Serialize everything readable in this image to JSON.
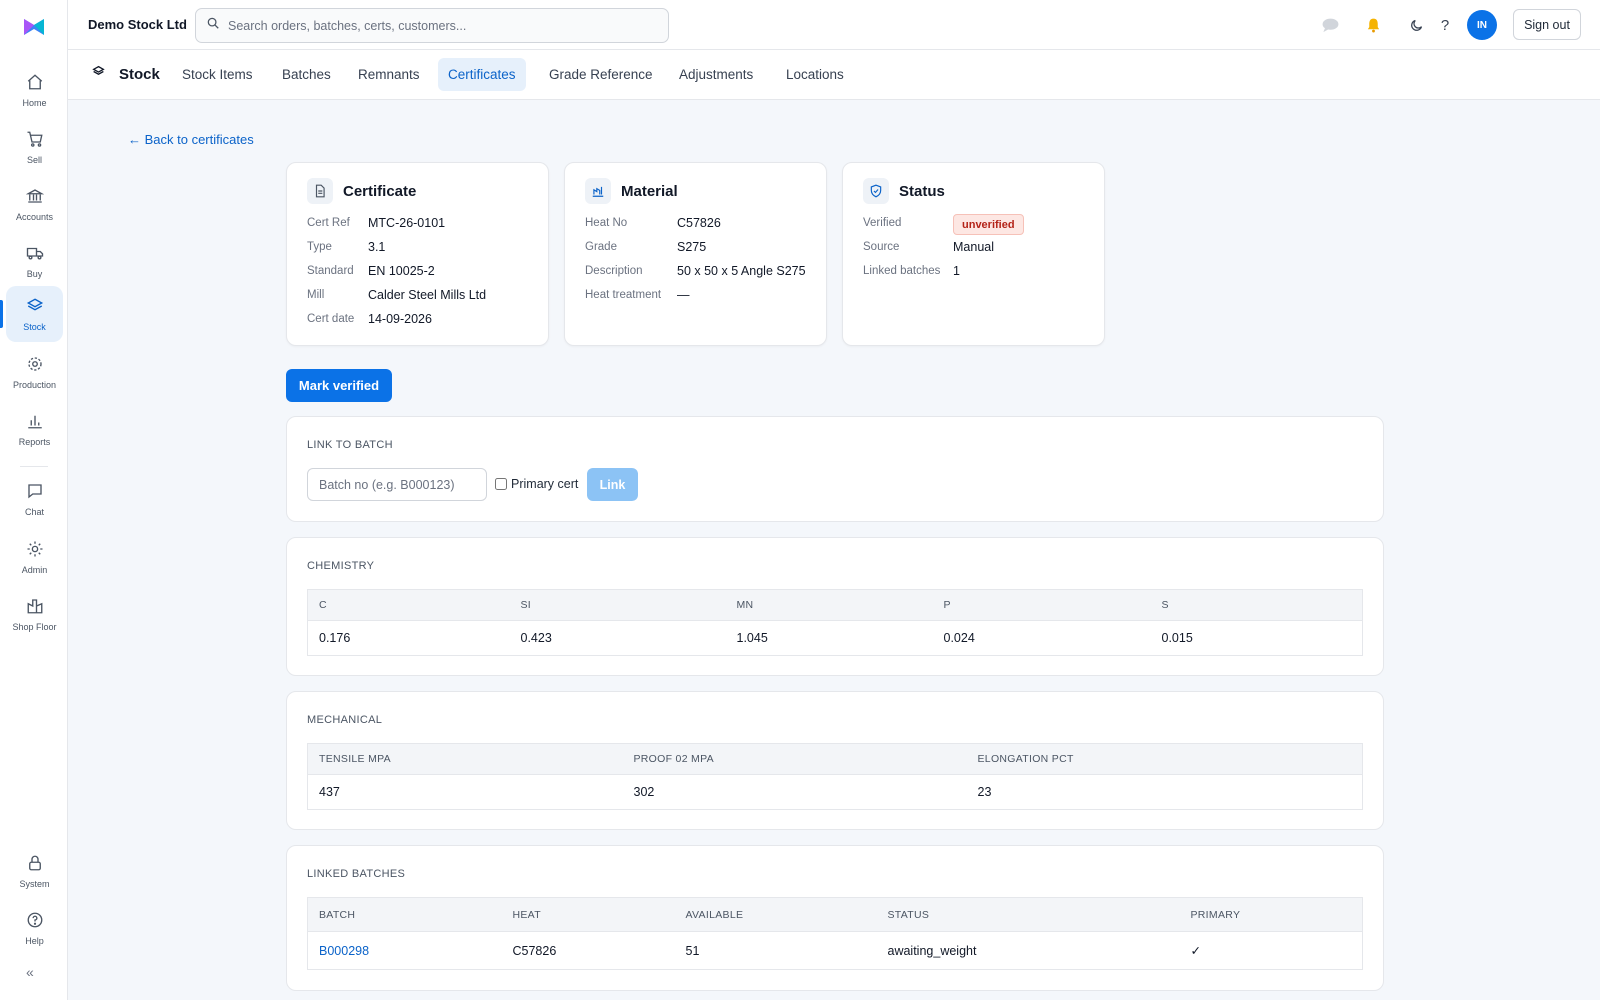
{
  "app": {
    "company": "Demo Stock Ltd",
    "search_placeholder": "Search orders, batches, certs, customers...",
    "avatar_initials": "IN",
    "sign_out": "Sign out"
  },
  "sidebar": {
    "items": [
      {
        "label": "Home",
        "icon": "home-icon"
      },
      {
        "label": "Sell",
        "icon": "cart-icon"
      },
      {
        "label": "Accounts",
        "icon": "bank-icon"
      },
      {
        "label": "Buy",
        "icon": "truck-icon"
      },
      {
        "label": "Stock",
        "icon": "layers-icon",
        "active": true
      },
      {
        "label": "Production",
        "icon": "gear-icon"
      },
      {
        "label": "Reports",
        "icon": "bar-chart-icon"
      },
      {
        "label": "Chat",
        "icon": "chat-icon"
      },
      {
        "label": "Admin",
        "icon": "sun-gear-icon"
      },
      {
        "label": "Shop Floor",
        "icon": "factory-icon"
      },
      {
        "label": "System",
        "icon": "lock-icon"
      },
      {
        "label": "Help",
        "icon": "help-icon"
      }
    ],
    "collapse": "«"
  },
  "subnav": {
    "title": "Stock",
    "tabs": [
      "Stock Items",
      "Batches",
      "Remnants",
      "Certificates",
      "Grade Reference",
      "Adjustments",
      "Locations"
    ],
    "active_tab": "Certificates"
  },
  "back_link": "← Back to certificates",
  "certificate": {
    "title": "Certificate",
    "fields": [
      {
        "label": "Cert Ref",
        "value": "MTC-26-0101"
      },
      {
        "label": "Type",
        "value": "3.1"
      },
      {
        "label": "Standard",
        "value": "EN 10025-2"
      },
      {
        "label": "Mill",
        "value": "Calder Steel Mills Ltd"
      },
      {
        "label": "Cert date",
        "value": "14-09-2026"
      }
    ]
  },
  "material": {
    "title": "Material",
    "fields": [
      {
        "label": "Heat No",
        "value": "C57826"
      },
      {
        "label": "Grade",
        "value": "S275"
      },
      {
        "label": "Description",
        "value": "50 x 50 x 5 Angle S275"
      },
      {
        "label": "Heat treatment",
        "value": "—"
      }
    ]
  },
  "status": {
    "title": "Status",
    "verified_label": "Verified",
    "verified_value": "unverified",
    "fields": [
      {
        "label": "Source",
        "value": "Manual"
      },
      {
        "label": "Linked batches",
        "value": "1"
      }
    ]
  },
  "mark_verified": "Mark verified",
  "link_to_batch": {
    "title": "LINK TO BATCH",
    "placeholder": "Batch no (e.g. B000123)",
    "primary_label": "Primary cert",
    "button": "Link"
  },
  "chemistry": {
    "title": "CHEMISTRY",
    "headers": [
      "C",
      "SI",
      "MN",
      "P",
      "S"
    ],
    "row": [
      "0.176",
      "0.423",
      "1.045",
      "0.024",
      "0.015"
    ]
  },
  "mechanical": {
    "title": "MECHANICAL",
    "headers": [
      "TENSILE MPA",
      "PROOF 02 MPA",
      "ELONGATION PCT"
    ],
    "row": [
      "437",
      "302",
      "23"
    ]
  },
  "linked_batches": {
    "title": "LINKED BATCHES",
    "headers": [
      "BATCH",
      "HEAT",
      "AVAILABLE",
      "STATUS",
      "PRIMARY"
    ],
    "rows": [
      [
        "B000298",
        "C57826",
        "51",
        "awaiting_weight",
        "✓"
      ]
    ]
  },
  "colors": {
    "accent": "#0b72e7",
    "badge_bg": "#fde7e3",
    "badge_text": "#b42318"
  }
}
